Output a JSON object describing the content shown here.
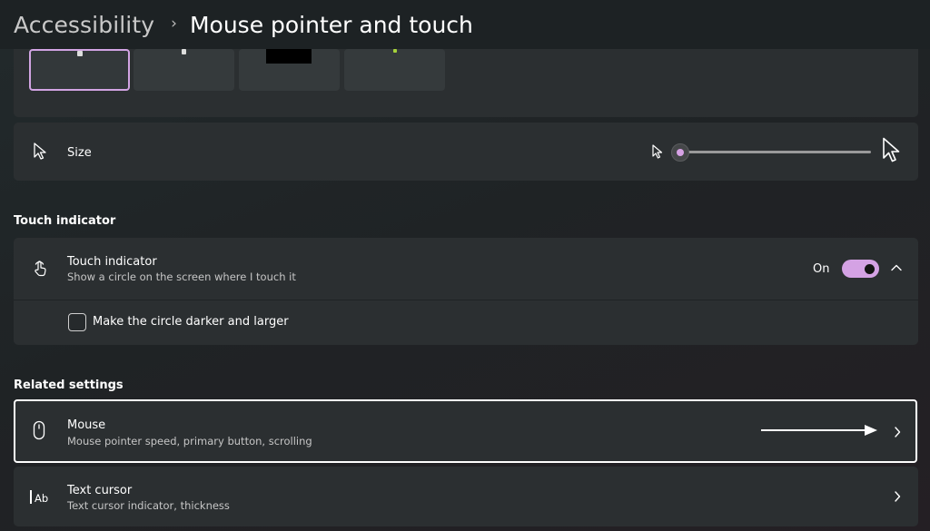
{
  "header": {
    "breadcrumb_root": "Accessibility",
    "breadcrumb_separator": "›",
    "page_title": "Mouse pointer and touch"
  },
  "pointer_style": {
    "options": [
      "style-white",
      "style-black",
      "style-inverted",
      "style-custom"
    ],
    "selected_index": 0
  },
  "size_row": {
    "label": "Size",
    "slider_value_fraction": 0.0
  },
  "touch_section": {
    "heading": "Touch indicator",
    "title": "Touch indicator",
    "subtitle": "Show a circle on the screen where I touch it",
    "state_label": "On",
    "toggle_on": true,
    "checkbox_label": "Make the circle darker and larger",
    "checkbox_checked": false
  },
  "related": {
    "heading": "Related settings",
    "items": [
      {
        "title": "Mouse",
        "subtitle": "Mouse pointer speed, primary button, scrolling",
        "icon": "mouse-icon"
      },
      {
        "title": "Text cursor",
        "subtitle": "Text cursor indicator, thickness",
        "icon": "text-cursor-icon"
      }
    ]
  },
  "colors": {
    "accent": "#d4a2e4",
    "background": "#202426",
    "card": "#2b2f31"
  }
}
